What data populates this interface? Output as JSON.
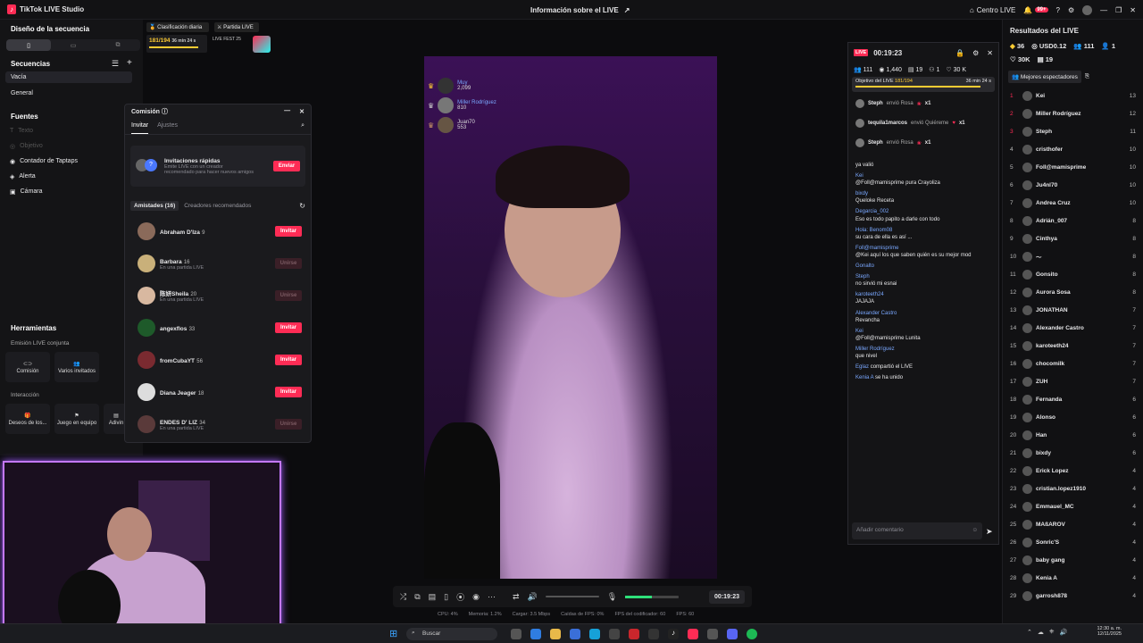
{
  "app": {
    "title": "TikTok LIVE Studio",
    "live_info": "Información sobre el LIVE",
    "center": "Centro LIVE",
    "notif_badge": "99+"
  },
  "colors": {
    "accent": "#fe2c55",
    "cam_border": "#c478ff",
    "chat_user": "#7aa8ff"
  },
  "left": {
    "design_title": "Diseño de la secuencia",
    "sequences_title": "Secuencias",
    "sequences": [
      "Vacía",
      "General"
    ],
    "sources_title": "Fuentes",
    "sources": [
      {
        "label": "Texto",
        "disabled": true
      },
      {
        "label": "Objetivo",
        "disabled": true
      },
      {
        "label": "Contador de Taptaps",
        "disabled": false
      },
      {
        "label": "Alerta",
        "disabled": false
      },
      {
        "label": "Cámara",
        "disabled": false
      }
    ],
    "tools_title": "Herramientas",
    "joint_label": "Emisión LIVE conjunta",
    "joint_tools": [
      "Comisión",
      "Varios invitados"
    ],
    "interaction_label": "Interacción",
    "interaction_tools": [
      "Deseos de los...",
      "Juego en equipo",
      "Adivin"
    ]
  },
  "widgets": {
    "daily": "Clasificación diaria",
    "daily_score": "181/194",
    "daily_time": "36 min 24 s",
    "partida": "Partida LIVE",
    "fest": "LIVE FEST 25"
  },
  "commission": {
    "title": "Comisión",
    "tabs": [
      "Invitar",
      "Ajustes"
    ],
    "quick_title": "Invitaciones rápidas",
    "quick_desc": "Emite LIVE con un creador recomendado para hacer nuevos amigos",
    "send": "Enviar",
    "friends_tab": "Amistades (16)",
    "recommended_tab": "Creadores recomendados",
    "friends": [
      {
        "name": "Abraham D'Iza",
        "count": "9",
        "sub": "",
        "action": "Invitar",
        "active": true
      },
      {
        "name": "Barbara",
        "count": "16",
        "sub": "En una partida LIVE",
        "action": "Unirse",
        "active": false
      },
      {
        "name": "陈妍Sheila",
        "count": "20",
        "sub": "En una partida LIVE",
        "action": "Unirse",
        "active": false
      },
      {
        "name": "angexflos",
        "count": "33",
        "sub": "",
        "action": "Invitar",
        "active": true
      },
      {
        "name": "fromCubaYT",
        "count": "56",
        "sub": "",
        "action": "Invitar",
        "active": true
      },
      {
        "name": "Diana Jeager",
        "count": "18",
        "sub": "",
        "action": "Invitar",
        "active": true
      },
      {
        "name": "ENDES D' LIZ",
        "count": "34",
        "sub": "En una partida LIVE",
        "action": "Unirse",
        "active": false
      }
    ]
  },
  "overlay_top": [
    {
      "name": "Muy",
      "score": "2,099"
    },
    {
      "name": "Miller Rodríguez",
      "score": "810"
    },
    {
      "name": "Juan70",
      "score": "553"
    }
  ],
  "toolbar": {
    "timer": "00:19:23"
  },
  "stats": [
    "CPU: 4%",
    "Memoria: 1.2%",
    "Cargar: 3.5 Mbps",
    "Caídas de FPS: 0%",
    "FPS del codificador: 60",
    "FPS: 60"
  ],
  "chat": {
    "live": "LIVE",
    "time": "00:19:23",
    "viewers": "111",
    "likes": "1,440",
    "shares": "19",
    "gifts": "1",
    "hearts": "30 K",
    "goal_label": "Objetivo del LIVE",
    "goal_score": "181/194",
    "goal_time": "36 min 24 s",
    "gifts_list": [
      {
        "user": "Steph",
        "action": "envió Rosa",
        "qty": "x1"
      },
      {
        "user": "tequila1marcos",
        "action": "envió Quiéreme",
        "qty": "x1"
      },
      {
        "user": "Steph",
        "action": "envió Rosa",
        "qty": "x1"
      }
    ],
    "messages": [
      {
        "user": "",
        "text": "ya valió"
      },
      {
        "user": "Kei",
        "text": "@Foll@mamisprime pura Crayoliza"
      },
      {
        "user": "bixdy",
        "text": "Queloke Receta"
      },
      {
        "user": "Degarcia_002",
        "text": "Eso es todo papito a darle con todo"
      },
      {
        "user": "Hola: Benom08",
        "text": "su cara de ella es así ..."
      },
      {
        "user": "Foll@mamisprime",
        "text": "@Kei aquí los que saben quién es su mejor mod"
      },
      {
        "user": "Gonalto",
        "text": ""
      },
      {
        "user": "Steph",
        "text": "no sirvió mi esnai"
      },
      {
        "user": "karoteeth24",
        "text": "JAJAJA"
      },
      {
        "user": "Alexander Castro",
        "text": "Revancha"
      },
      {
        "user": "Kei",
        "text": "@Foll@mamisprime Lunita"
      },
      {
        "user": "Miller Rodríguez",
        "text": "que nivel"
      },
      {
        "user": "Eglaz",
        "text": "compartió el LIVE"
      },
      {
        "user": "Kenia A",
        "text": "se ha unido"
      }
    ],
    "input_placeholder": "Añadir comentario"
  },
  "results": {
    "title": "Resultados del LIVE",
    "s1": "36",
    "s2": "USD0.12",
    "s3": "111",
    "s4": "1",
    "s5": "30K",
    "s6": "19",
    "best": "Mejores espectadores",
    "ranking": [
      {
        "n": "1",
        "name": "Kei",
        "v": "13"
      },
      {
        "n": "2",
        "name": "Miller Rodríguez",
        "v": "12"
      },
      {
        "n": "3",
        "name": "Steph",
        "v": "11"
      },
      {
        "n": "4",
        "name": "cristhofer",
        "v": "10"
      },
      {
        "n": "5",
        "name": "Foll@mamisprime",
        "v": "10"
      },
      {
        "n": "6",
        "name": "Ju4nl70",
        "v": "10"
      },
      {
        "n": "7",
        "name": "Andrea Cruz",
        "v": "10"
      },
      {
        "n": "8",
        "name": "Adrián_007",
        "v": "8"
      },
      {
        "n": "9",
        "name": "Cinthya",
        "v": "8"
      },
      {
        "n": "10",
        "name": "～",
        "v": "8"
      },
      {
        "n": "11",
        "name": "Gonsito",
        "v": "8"
      },
      {
        "n": "12",
        "name": "Aurora Sosa",
        "v": "8"
      },
      {
        "n": "13",
        "name": "JONATHAN",
        "v": "7"
      },
      {
        "n": "14",
        "name": "Alexander Castro",
        "v": "7"
      },
      {
        "n": "15",
        "name": "karoteeth24",
        "v": "7"
      },
      {
        "n": "16",
        "name": "chocomilk",
        "v": "7"
      },
      {
        "n": "17",
        "name": "ZUH",
        "v": "7"
      },
      {
        "n": "18",
        "name": "Fernanda",
        "v": "6"
      },
      {
        "n": "19",
        "name": "Alonso",
        "v": "6"
      },
      {
        "n": "20",
        "name": "Han",
        "v": "6"
      },
      {
        "n": "21",
        "name": "bixdy",
        "v": "6"
      },
      {
        "n": "22",
        "name": "Erick Lopez",
        "v": "4"
      },
      {
        "n": "23",
        "name": "cristian.lopez1910",
        "v": "4"
      },
      {
        "n": "24",
        "name": "Emmauel_MC",
        "v": "4"
      },
      {
        "n": "25",
        "name": "MAßAROV",
        "v": "4"
      },
      {
        "n": "26",
        "name": "Sonric'S",
        "v": "4"
      },
      {
        "n": "27",
        "name": "baby gang",
        "v": "4"
      },
      {
        "n": "28",
        "name": "Kenia A",
        "v": "4"
      },
      {
        "n": "29",
        "name": "garrosh878",
        "v": "4"
      }
    ]
  },
  "taskbar": {
    "search": "Buscar",
    "time": "12:30 a. m.",
    "date": "12/11/2025"
  }
}
